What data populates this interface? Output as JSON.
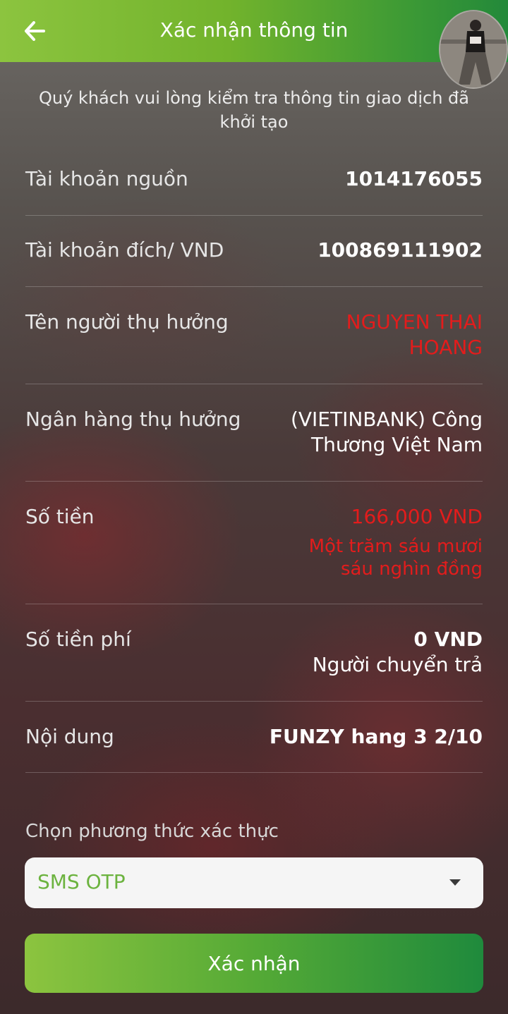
{
  "header": {
    "title": "Xác nhận thông tin",
    "back_icon": "arrow-left-icon"
  },
  "subtitle": "Quý khách vui lòng kiểm tra thông tin giao dịch đã khởi tạo",
  "rows": [
    {
      "label": "Tài khoản nguồn",
      "value": "1014176055"
    },
    {
      "label": "Tài khoản đích/ VND",
      "value": "100869111902"
    },
    {
      "label": "Tên người thụ hưởng",
      "value": "NGUYEN THAI HOANG"
    },
    {
      "label": "Ngân hàng thụ hưởng",
      "value": "(VIETINBANK) Công Thương Việt Nam"
    },
    {
      "label": "Số tiền",
      "value": "166,000 VND",
      "sub": "Một trăm sáu mươi sáu nghìn đồng"
    },
    {
      "label": "Số tiền phí",
      "value": "0 VND",
      "sub": "Người chuyển trả"
    },
    {
      "label": "Nội dung",
      "value": "FUNZY hang 3 2/10"
    }
  ],
  "auth": {
    "label": "Chọn phương thức xác thực",
    "selected": "SMS OTP"
  },
  "confirm_label": "Xác nhận",
  "colors": {
    "brand_green": "#72b32c",
    "highlight_red": "#e31c1c",
    "select_text_green": "#6cb33f"
  }
}
